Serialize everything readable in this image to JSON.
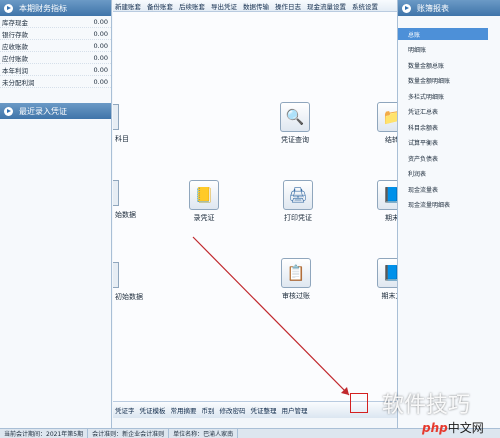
{
  "topbar": {
    "items": [
      "新建账套",
      "备份账套",
      "后续账套",
      "导出凭证",
      "数据传输",
      "操作日志",
      "现金流量设置",
      "系统设置"
    ]
  },
  "finance_panel": {
    "title": "本期财务指标",
    "rows": [
      {
        "label": "库存现金",
        "value": "0.00"
      },
      {
        "label": "银行存款",
        "value": "0.00"
      },
      {
        "label": "应收账款",
        "value": "0.00"
      },
      {
        "label": "应付账款",
        "value": "0.00"
      },
      {
        "label": "本年利润",
        "value": "0.00"
      },
      {
        "label": "未分配利润",
        "value": "0.00"
      }
    ]
  },
  "recent_panel": {
    "title": "最近录入凭证"
  },
  "workflow": {
    "clipped_labels": [
      "科目",
      "始数据",
      "初始数据"
    ],
    "nodes": [
      {
        "label": "凭证查询",
        "icon": "magnifier-icon"
      },
      {
        "label": "结转",
        "icon": "folder-icon"
      },
      {
        "label": "录凭证",
        "icon": "voucher-icon"
      },
      {
        "label": "打印凭证",
        "icon": "printer-icon"
      },
      {
        "label": "期末",
        "icon": "ledger-icon"
      },
      {
        "label": "审核过账",
        "icon": "audit-icon"
      },
      {
        "label": "期末方",
        "icon": "ledger-icon"
      }
    ],
    "glyphs": {
      "search": "🔍",
      "voucher": "📒",
      "print": "🖨",
      "audit": "📋",
      "ledger": "📘",
      "folder": "📁"
    }
  },
  "toolbar": {
    "items": [
      "凭证字",
      "凭证模板",
      "常用摘要",
      "币别",
      "修改密码",
      "凭证整理",
      "用户管理"
    ]
  },
  "report_panel": {
    "title": "账簿报表",
    "items": [
      "总账",
      "明细账",
      "数量金额总账",
      "数量金额明细账",
      "多栏式明细账",
      "凭证汇总表",
      "科目余额表",
      "试算平衡表",
      "资产负债表",
      "利润表",
      "现金流量表",
      "现金流量明细表"
    ]
  },
  "status": {
    "period": "当前会计期间：2021年第5期",
    "standard": "会计准则：新企业会计准则",
    "company": "单位名称：巴渝人家南"
  },
  "watermark": {
    "text": "软件技巧",
    "logo_prefix": "php",
    "logo_suffix": "中文网"
  },
  "colors": {
    "panel_header": "#4a7fb5",
    "selected": "#4d90d8",
    "arrow": "#c0282d"
  }
}
